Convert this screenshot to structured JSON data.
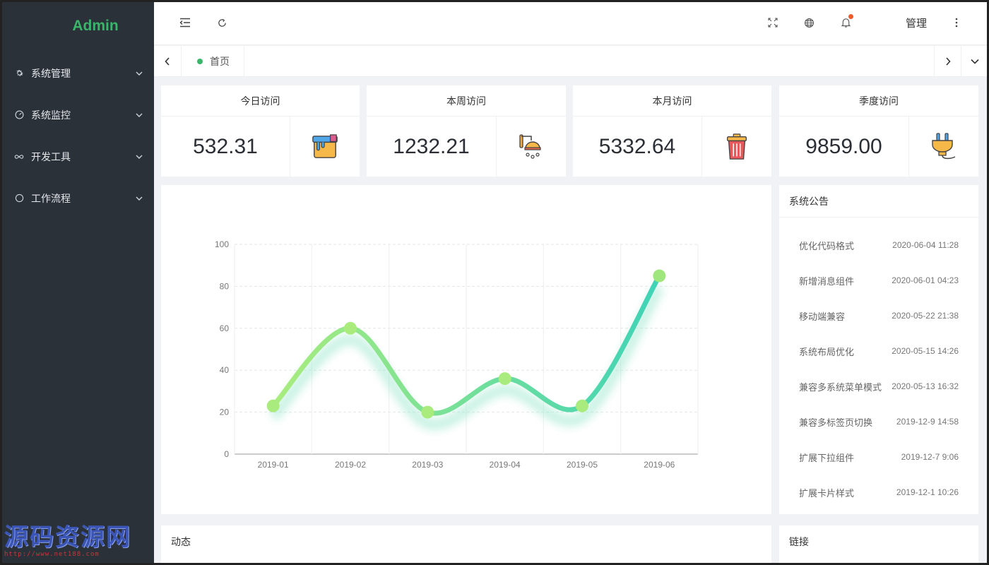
{
  "sidebar": {
    "brand": "Admin",
    "items": [
      {
        "label": "系统管理",
        "icon": "gear-icon"
      },
      {
        "label": "系统监控",
        "icon": "dashboard-icon"
      },
      {
        "label": "开发工具",
        "icon": "infinity-icon"
      },
      {
        "label": "工作流程",
        "icon": "circle-icon"
      }
    ],
    "watermark": {
      "title": "源码资源网",
      "url": "http://www.net188.com"
    }
  },
  "header": {
    "user_name": "管理",
    "icons": [
      "menu-fold-icon",
      "refresh-icon",
      "fullscreen-icon",
      "globe-icon",
      "bell-icon",
      "more-vertical-icon"
    ],
    "notification_color": "#f05b2a"
  },
  "tabs": {
    "items": [
      {
        "label": "首页",
        "active": true
      }
    ],
    "accent": "#3bb56a"
  },
  "stats": [
    {
      "title": "今日访问",
      "value": "532.31",
      "icon": "paint-bucket-icon"
    },
    {
      "title": "本周访问",
      "value": "1232.21",
      "icon": "shower-icon"
    },
    {
      "title": "本月访问",
      "value": "5332.64",
      "icon": "trash-can-icon"
    },
    {
      "title": "季度访问",
      "value": "9859.00",
      "icon": "plug-icon"
    }
  ],
  "chart_data": {
    "type": "line",
    "smooth": true,
    "categories": [
      "2019-01",
      "2019-02",
      "2019-03",
      "2019-04",
      "2019-05",
      "2019-06"
    ],
    "values": [
      23,
      60,
      20,
      36,
      23,
      85
    ],
    "ylim": [
      0,
      100
    ],
    "yticks": [
      0,
      20,
      40,
      60,
      80,
      100
    ],
    "grid": true,
    "gradient": [
      "#a9ec7d",
      "#3fd3b7"
    ]
  },
  "announcements": {
    "title": "系统公告",
    "items": [
      {
        "text": "优化代码格式",
        "date": "2020-06-04 11:28"
      },
      {
        "text": "新增消息组件",
        "date": "2020-06-01 04:23"
      },
      {
        "text": "移动端兼容",
        "date": "2020-05-22 21:38"
      },
      {
        "text": "系统布局优化",
        "date": "2020-05-15 14:26"
      },
      {
        "text": "兼容多系统菜单模式",
        "date": "2020-05-13 16:32"
      },
      {
        "text": "兼容多标签页切换",
        "date": "2019-12-9 14:58"
      },
      {
        "text": "扩展下拉组件",
        "date": "2019-12-7 9:06"
      },
      {
        "text": "扩展卡片样式",
        "date": "2019-12-1 10:26"
      }
    ]
  },
  "activity": {
    "title": "动态"
  },
  "links": {
    "title": "链接"
  }
}
